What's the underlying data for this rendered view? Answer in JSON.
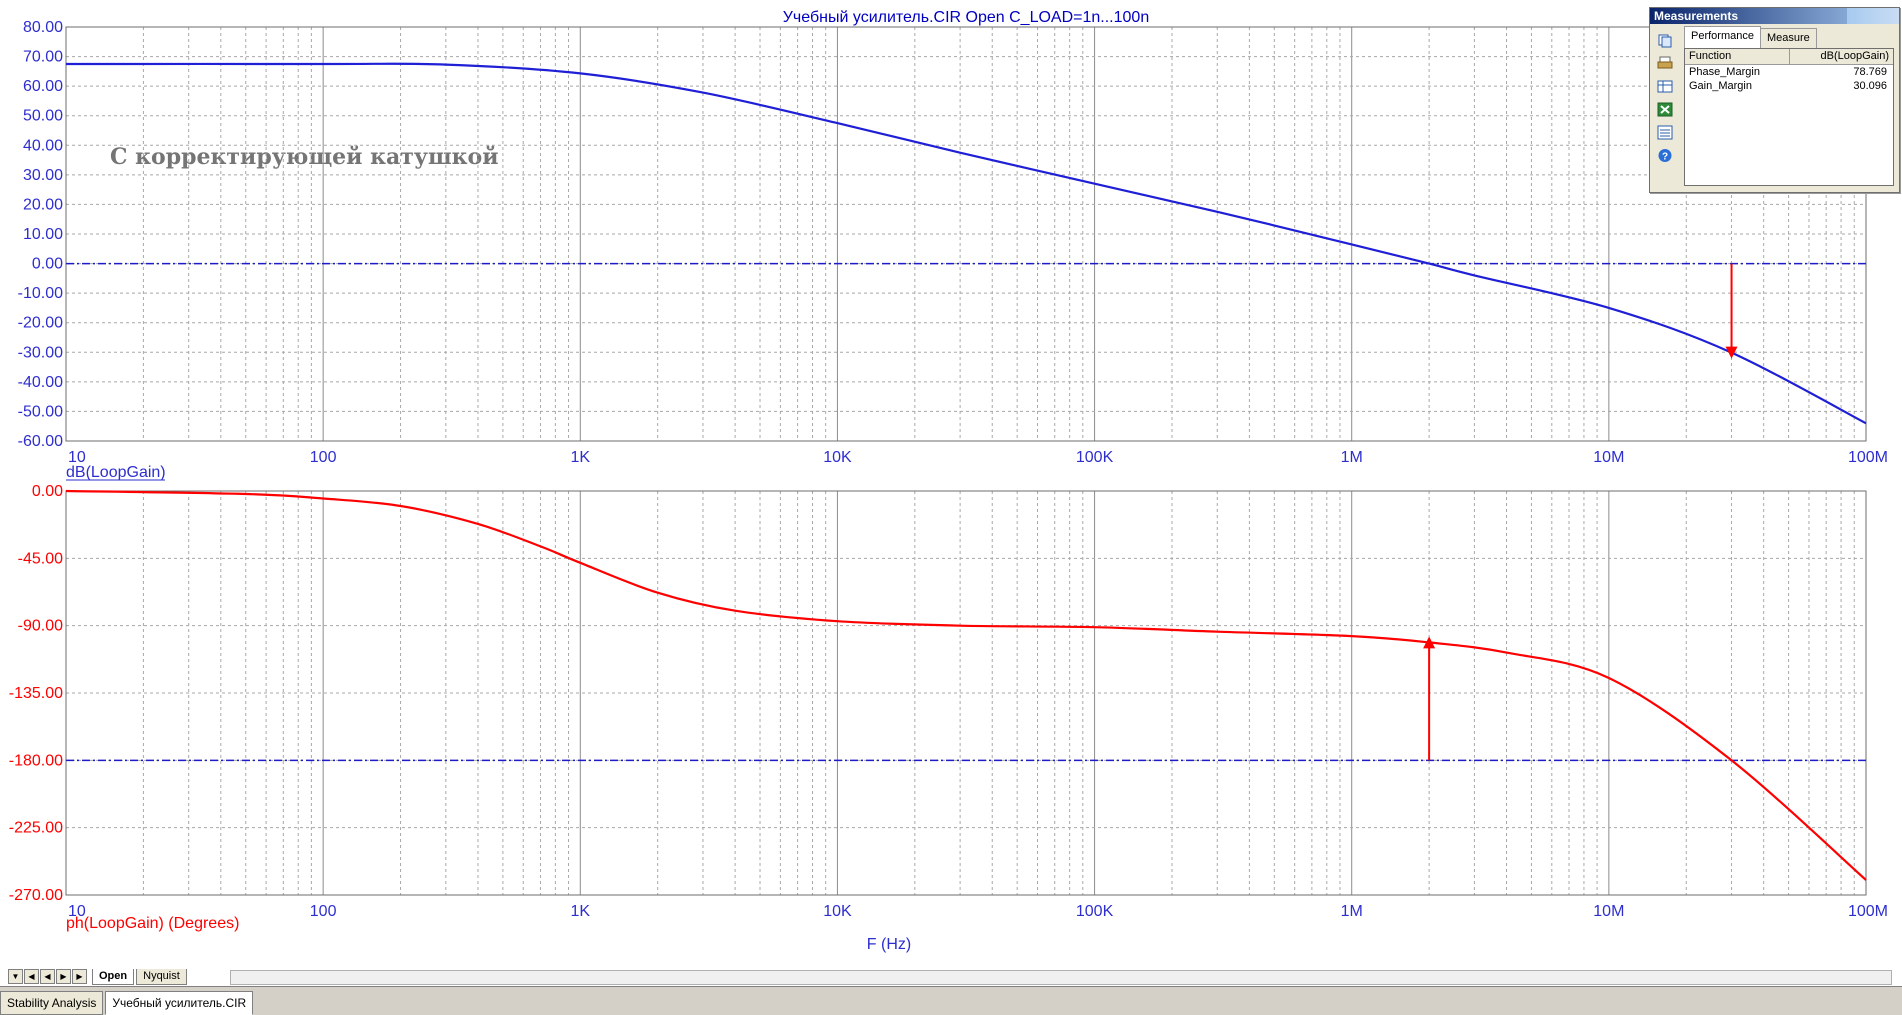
{
  "title": "Учебный усилитель.CIR Open C_LOAD=1n...100n",
  "annotation": "С корректирующей катушкой",
  "colors": {
    "gain": "#1f1fd6",
    "phase": "#ff0000",
    "axis_text": "#2e2ecf",
    "title": "#0000c0",
    "grid": "#a8a8a8",
    "marker": "#ff0000"
  },
  "x_axis": {
    "label": "F (Hz)",
    "ticks": [
      "10",
      "100",
      "1K",
      "10K",
      "100K",
      "1M",
      "10M",
      "100M"
    ]
  },
  "chart_data": [
    {
      "type": "line",
      "title": "Учебный усилитель.CIR Open C_LOAD=1n...100n",
      "xlabel": "",
      "ylabel": "dB(LoopGain)",
      "xscale": "log",
      "xlim": [
        10,
        100000000
      ],
      "ylim": [
        -60,
        80
      ],
      "yticks": [
        "80.00",
        "70.00",
        "60.00",
        "50.00",
        "40.00",
        "30.00",
        "20.00",
        "10.00",
        "0.00",
        "-10.00",
        "-20.00",
        "-30.00",
        "-40.00",
        "-50.00",
        "-60.00"
      ],
      "grid": true,
      "reference_line": 0,
      "marker_arrow": {
        "x": 30000000,
        "from_y": 0,
        "to_y": -30.1
      },
      "series": [
        {
          "name": "dB(LoopGain)",
          "x": [
            10,
            100,
            300,
            1000,
            3000,
            10000,
            30000,
            100000,
            300000,
            1000000,
            2000000,
            3000000,
            10000000,
            30000000,
            100000000
          ],
          "y": [
            67.5,
            67.5,
            67.3,
            64.3,
            57.8,
            47.5,
            37.5,
            27,
            17.5,
            6.5,
            0,
            -4,
            -15,
            -30.1,
            -54
          ]
        }
      ]
    },
    {
      "type": "line",
      "xlabel": "F (Hz)",
      "ylabel": "ph(LoopGain) (Degrees)",
      "xscale": "log",
      "xlim": [
        10,
        100000000
      ],
      "ylim": [
        -270,
        0
      ],
      "yticks": [
        "0.00",
        "-45.00",
        "-90.00",
        "-135.00",
        "-180.00",
        "-225.00",
        "-270.00"
      ],
      "grid": true,
      "reference_line": -180,
      "marker_arrow": {
        "x": 2000000,
        "from_y": -180,
        "to_y": -101.2
      },
      "series": [
        {
          "name": "ph(LoopGain) (Degrees)",
          "x": [
            10,
            50,
            100,
            200,
            400,
            700,
            1000,
            2000,
            4000,
            10000,
            30000,
            100000,
            300000,
            1000000,
            2000000,
            4000000,
            10000000,
            30000000,
            100000000
          ],
          "y": [
            0,
            -2,
            -5,
            -10,
            -22,
            -37,
            -48,
            -68,
            -80,
            -87,
            -90,
            -91,
            -94,
            -97,
            -101.2,
            -108,
            -125,
            -180,
            -260
          ]
        }
      ]
    }
  ],
  "measurements": {
    "panel_title": "Measurements",
    "tabs": [
      "Performance",
      "Measure"
    ],
    "header": {
      "function": "Function",
      "value": "dB(LoopGain)"
    },
    "rows": [
      {
        "function": "Phase_Margin",
        "value": "78.769"
      },
      {
        "function": "Gain_Margin",
        "value": "30.096"
      }
    ]
  },
  "sheet_tabs": [
    "Open",
    "Nyquist"
  ],
  "window_tabs": [
    "Stability Analysis",
    "Учебный усилитель.CIR"
  ]
}
